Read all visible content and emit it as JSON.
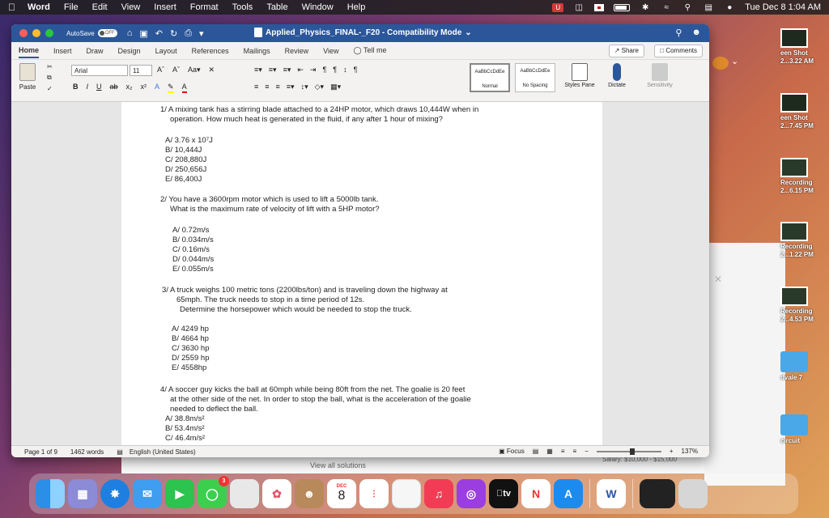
{
  "menubar": {
    "app_name": "Word",
    "items": [
      "File",
      "Edit",
      "View",
      "Insert",
      "Format",
      "Tools",
      "Table",
      "Window",
      "Help"
    ],
    "clock": "Tue Dec 8  1:04 AM"
  },
  "window": {
    "autosave_label": "AutoSave",
    "autosave_state": "OFF",
    "title": "Applied_Physics_FINAL-_F20  -  Compatibility Mode",
    "tabs": [
      "Home",
      "Insert",
      "Draw",
      "Design",
      "Layout",
      "References",
      "Mailings",
      "Review",
      "View"
    ],
    "tell_me": "Tell me",
    "share": "Share",
    "comments": "Comments"
  },
  "ribbon": {
    "paste": "Paste",
    "font": "Arial",
    "size": "11",
    "style_normal": "Normal",
    "style_nospacing": "No Spacing",
    "style_sample": "AaBbCcDdEe",
    "styles_pane": "Styles Pane",
    "dictate": "Dictate",
    "sensitivity": "Sensitivity"
  },
  "questions": [
    {
      "stem": "1/ A mixing tank has a stirring blade attached to a 24HP motor, which draws 10,444W when in",
      "stem2": "operation. How much heat is generated in the fluid, if any after 1 hour of mixing?",
      "answers": [
        "A/ 3.76 x 10⁷J",
        "B/ 10,444J",
        "C/ 208,880J",
        "D/ 250,656J",
        "E/ 86,400J"
      ]
    },
    {
      "stem": "2/ You have a 3600rpm motor which is used to lift a 5000lb tank.",
      "stem2": "What is the maximum rate of velocity of lift with a 5HP motor?",
      "answers": [
        "A/ 0.72m/s",
        "B/ 0.034m/s",
        "C/ 0.16m/s",
        "D/ 0.044m/s",
        "E/ 0.055m/s"
      ]
    },
    {
      "stem": "3/  A truck weighs 100 metric  tons (2200lbs/ton) and is traveling down the highway at",
      "stem2": "65mph. The truck needs to stop in a  time period of 12s.",
      "stem3": "Determine the horsepower which would be needed to stop the truck.",
      "answers": [
        "A/ 4249 hp",
        "B/ 4664 hp",
        "C/ 3630 hp",
        "D/ 2559 hp",
        "E/ 4558hp"
      ]
    },
    {
      "stem": "4/ A soccer guy kicks the ball at 60mph while being 80ft from the net. The goalie is 20 feet",
      "stem2": "at  the other side of the net. In order to stop the ball, what is the acceleration of the goalie",
      "stem3": "needed to deflect the ball.",
      "answers": [
        "A/ 38.8m/s²",
        "B/ 53.4m/s²",
        "C/ 46.4m/s²"
      ]
    }
  ],
  "statusbar": {
    "page": "Page 1 of 9",
    "words": "1462 words",
    "language": "English (United States)",
    "focus": "Focus",
    "zoom": "137%",
    "zoom_level": 0.55
  },
  "desktop": {
    "items": [
      "een Shot\n2...3.22 AM",
      "een Shot\n2...7.45 PM",
      "Recording\n2...6.15 PM",
      "Recording\n2...1.22 PM",
      "Recording\n2...4.53 PM",
      "dvale 7",
      "circuit"
    ]
  },
  "background": {
    "view_all": "View all solutions",
    "salary": "Salary: $10,000 - $15,000"
  },
  "dock": {
    "calendar_month": "DEC",
    "calendar_day": "8",
    "messages_badge": "3",
    "tv_label": "tv"
  }
}
